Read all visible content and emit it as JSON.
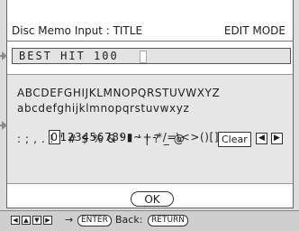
{
  "header": {
    "title": "Disc Memo Input : TITLE",
    "mode": "EDIT MODE"
  },
  "memo_field": {
    "value": "BEST HIT 100"
  },
  "char_grid": {
    "row_upper": "ABCDEFGHIJKLMNOPQRSTUVWXYZ",
    "row_lower": "abcdefghijklmnopqrstuvwxyz",
    "digit_selected": "0",
    "row_digits_rest": "123456789▮~+-*/=\\<>()[]{}",
    "row_symbols": ": ; , . ! \" # $ % & ' ` ' | ? _ @",
    "clear_label": "Clear",
    "left_icon": "left-arrow-icon",
    "right_icon": "right-arrow-icon"
  },
  "actions": {
    "ok_label": "OK"
  },
  "footer": {
    "arrows_hint": "→",
    "enter_label": "ENTER",
    "back_label": "Back:",
    "return_label": "RETURN"
  }
}
